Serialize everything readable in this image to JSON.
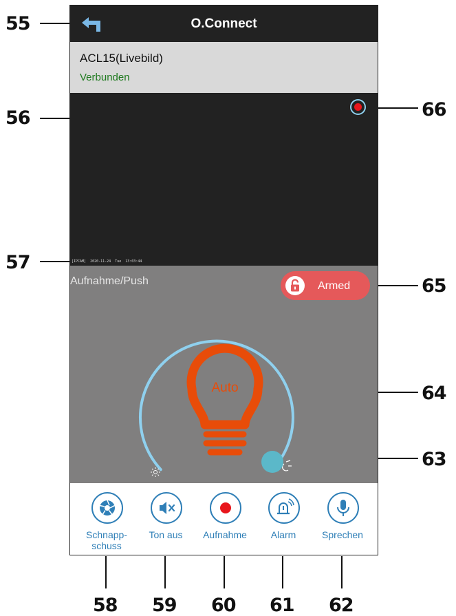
{
  "app": {
    "title": "O.Connect"
  },
  "camera": {
    "name": "ACL15(Livebild)",
    "status": "Verbunden"
  },
  "video": {
    "osd": "[IPCAM]  2020-11-24  Tue  13:03:44"
  },
  "control": {
    "push_label": "Aufnahme/Push",
    "armed_label": "Armed",
    "light_mode": "Auto",
    "light_level_fraction": 0.02
  },
  "toolbar": {
    "items": [
      {
        "label": "Schnapp-\nschuss",
        "icon": "camera-shutter-icon"
      },
      {
        "label": "Ton aus",
        "icon": "speaker-mute-icon"
      },
      {
        "label": "Aufnahme",
        "icon": "record-icon"
      },
      {
        "label": "Alarm",
        "icon": "alarm-light-icon"
      },
      {
        "label": "Sprechen",
        "icon": "microphone-icon"
      }
    ]
  },
  "callouts": {
    "c55": "55",
    "c56": "56",
    "c57": "57",
    "c58": "58",
    "c59": "59",
    "c60": "60",
    "c61": "61",
    "c62": "62",
    "c63": "63",
    "c64": "64",
    "c65": "65",
    "c66": "66"
  },
  "colors": {
    "accent_blue": "#2f7fb7",
    "dial_blue": "#8fd0ee",
    "bulb_orange": "#e84c09",
    "armed_red": "#e5595a",
    "connected_green": "#1f7a1f"
  }
}
